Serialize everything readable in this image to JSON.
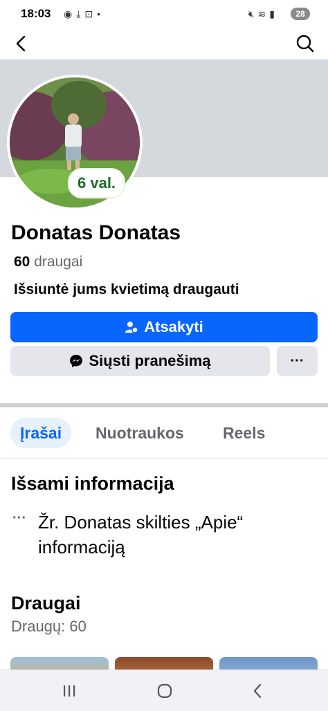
{
  "status_bar": {
    "time": "18:03",
    "left_icons": [
      "messenger-icon",
      "download-icon",
      "screenshot-icon",
      "dot-icon"
    ],
    "right_icons": [
      "mute-icon",
      "wifi-icon",
      "signal-icon"
    ],
    "battery": "28"
  },
  "nav": {
    "back_icon": "chevron-left-icon",
    "search_icon": "search-icon"
  },
  "profile": {
    "time_badge": "6 val.",
    "name": "Donatas Donatas",
    "friends_count": "60",
    "friends_label": "draugai",
    "invite_text": "Išsiuntė jums kvietimą draugauti"
  },
  "buttons": {
    "respond": "Atsakyti",
    "message": "Siųsti pranešimą",
    "more": "···"
  },
  "tabs": [
    {
      "label": "Įrašai",
      "active": true
    },
    {
      "label": "Nuotraukos",
      "active": false
    },
    {
      "label": "Reels",
      "active": false
    }
  ],
  "about": {
    "title": "Išsami informacija",
    "dots": "···",
    "text": "Žr. Donatas skilties „Apie“ informaciją"
  },
  "friends_section": {
    "title": "Draugai",
    "subtitle": "Draugų: 60"
  },
  "colors": {
    "accent": "#0866ff",
    "cover": "#d5d8dc",
    "button_gray": "#e4e6eb",
    "badge_green": "#1d6b2a"
  },
  "system_nav": [
    "recents-icon",
    "home-icon",
    "back-icon"
  ]
}
